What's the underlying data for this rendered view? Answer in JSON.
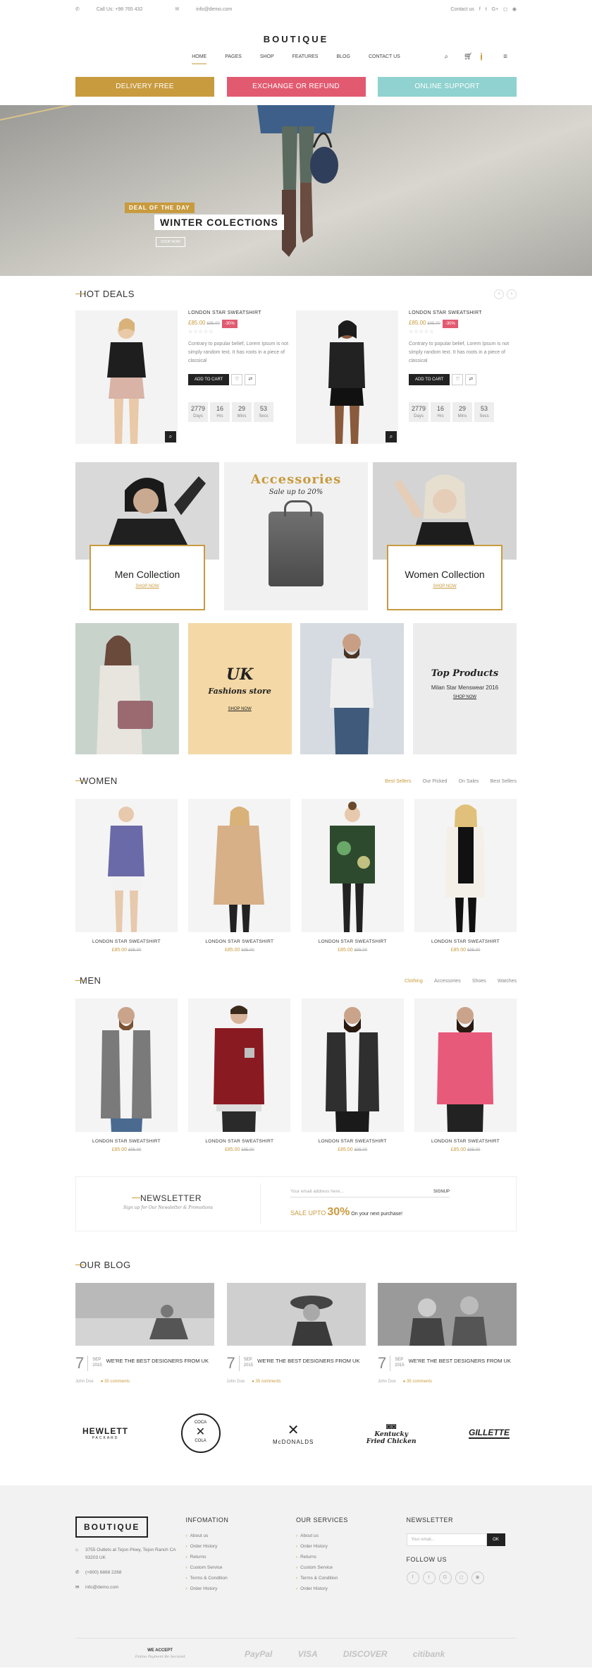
{
  "topbar": {
    "phone": "Call Us: +98 765 432",
    "email": "info@demo.com",
    "contact": "Contact us",
    "social_icons": [
      "facebook-icon",
      "twitter-icon",
      "google-plus-icon",
      "instagram-icon",
      "pinterest-icon"
    ]
  },
  "brand": {
    "name": "BOUTIQUE"
  },
  "nav": {
    "items": [
      "HOME",
      "PAGES",
      "SHOP",
      "FEATURES",
      "BLOG",
      "CONTACT US"
    ],
    "cart_count": "0"
  },
  "promos": [
    {
      "label": "DELIVERY FREE",
      "color": "#c89b3f"
    },
    {
      "label": "EXCHANGE OR REFUND",
      "color": "#e25a70"
    },
    {
      "label": "ONLINE SUPPORT",
      "color": "#8fd2cf"
    }
  ],
  "hero": {
    "tag": "DEAL OF THE DAY",
    "title": "WINTER COLECTIONS",
    "button": "SHOP NOW"
  },
  "hot_deals": {
    "title": "HOT DEALS",
    "items": [
      {
        "name": "LONDON STAR SWEATSHIRT",
        "price": "£85.00",
        "old_price": "£95.00",
        "discount": "-30%",
        "desc": "Contrary to popular belief, Lorem Ipsum is not simply random text. It has roots in a piece of classical",
        "add_to_cart": "ADD TO CART",
        "timer": {
          "days": "2779",
          "hrs": "16",
          "mins": "29",
          "secs": "53"
        }
      },
      {
        "name": "LONDON STAR SWEATSHIRT",
        "price": "£85.00",
        "old_price": "£95.00",
        "discount": "-30%",
        "desc": "Contrary to popular belief, Lorem Ipsum is not simply random text. It has roots in a piece of classical",
        "add_to_cart": "ADD TO CART",
        "timer": {
          "days": "2779",
          "hrs": "16",
          "mins": "29",
          "secs": "53"
        }
      }
    ],
    "labels": {
      "days": "Days",
      "hrs": "Hrs",
      "mins": "Mins",
      "secs": "Secs"
    }
  },
  "collections": {
    "men": {
      "title": "Men Collection",
      "link": "SHOP NOW"
    },
    "accessories": {
      "title": "Accessories",
      "subtitle": "Sale up to 20%"
    },
    "women": {
      "title": "Women Collection",
      "link": "SHOP NOW"
    }
  },
  "promo_tiles": {
    "uk": {
      "title": "UK",
      "subtitle": "Fashions store",
      "link": "SHOP NOW"
    },
    "top": {
      "title": "Top Products",
      "subtitle": "Milan Star Menswear 2016",
      "link": "SHOP NOW"
    }
  },
  "women": {
    "title": "WOMEN",
    "tabs": [
      "Best Sellers",
      "Our Picked",
      "On Sales",
      "Best Sellers"
    ],
    "products": [
      {
        "name": "LONDON STAR SWEATSHIRT",
        "price": "£85.00",
        "old_price": "£95.00"
      },
      {
        "name": "LONDON STAR SWEATSHIRT",
        "price": "£85.00",
        "old_price": "£95.00"
      },
      {
        "name": "LONDON STAR SWEATSHIRT",
        "price": "£85.00",
        "old_price": "£95.00"
      },
      {
        "name": "LONDON STAR SWEATSHIRT",
        "price": "£85.00",
        "old_price": "£95.00"
      }
    ]
  },
  "men": {
    "title": "MEN",
    "tabs": [
      "Clothing",
      "Accessories",
      "Shoes",
      "Watches"
    ],
    "products": [
      {
        "name": "LONDON STAR SWEATSHIRT",
        "price": "£85.00",
        "old_price": "£95.00"
      },
      {
        "name": "LONDON STAR SWEATSHIRT",
        "price": "£85.00",
        "old_price": "£95.00"
      },
      {
        "name": "LONDON STAR SWEATSHIRT",
        "price": "£85.00",
        "old_price": "£95.00"
      },
      {
        "name": "LONDON STAR SWEATSHIRT",
        "price": "£85.00",
        "old_price": "£95.00"
      }
    ]
  },
  "newsletter": {
    "title": "NEWSLETTER",
    "subtitle": "Sign up for Our Newsletter & Promotions",
    "placeholder": "Your email address here...",
    "button": "SIGNUP",
    "sale_prefix": "SALE UPTO",
    "sale_value": "30%",
    "sale_suffix": "On your next purchase!"
  },
  "blog": {
    "title": "OUR BLOG",
    "posts": [
      {
        "day": "7",
        "month": "SEP",
        "year": "2015",
        "title": "WE'RE THE BEST DESIGNERS FROM UK",
        "author": "John Doe",
        "comments": "35 comments"
      },
      {
        "day": "7",
        "month": "SEP",
        "year": "2015",
        "title": "WE'RE THE BEST DESIGNERS FROM UK",
        "author": "John Doe",
        "comments": "35 comments"
      },
      {
        "day": "7",
        "month": "SEP",
        "year": "2015",
        "title": "WE'RE THE BEST DESIGNERS FROM UK",
        "author": "John Doe",
        "comments": "35 comments"
      }
    ]
  },
  "brands": [
    {
      "line1": "HEWLETT",
      "line2": "PACKARD"
    },
    {
      "line1": "COCA",
      "line2": "COLA"
    },
    {
      "line1": "McDONALDS",
      "line2": ""
    },
    {
      "line1": "Kentucky",
      "line2": "Fried Chicken"
    },
    {
      "line1": "GILLETTE",
      "line2": ""
    }
  ],
  "footer": {
    "logo": "BOUTIQUE",
    "address": "3755 Outlets at Tejon Pkwy, Tejon Ranch CA 93203 UK",
    "phone": "(+800) 6868 2268",
    "email": "info@demo.com",
    "info": {
      "title": "INFOMATION",
      "links": [
        "About us",
        "Order History",
        "Returns",
        "Custom Service",
        "Terms & Condition",
        "Order History"
      ]
    },
    "services": {
      "title": "OUR SERVICES",
      "links": [
        "About us",
        "Order History",
        "Returns",
        "Custom Service",
        "Terms & Condition",
        "Order History"
      ]
    },
    "newsletter": {
      "title": "NEWSLETTER",
      "placeholder": "Your email...",
      "button": "OK",
      "follow": "FOLLOW US"
    },
    "accept": {
      "title": "WE ACCEPT",
      "subtitle": "Online Payment Be Secured"
    },
    "payments": [
      "PayPal",
      "VISA",
      "DISCOVER",
      "citibank"
    ]
  }
}
